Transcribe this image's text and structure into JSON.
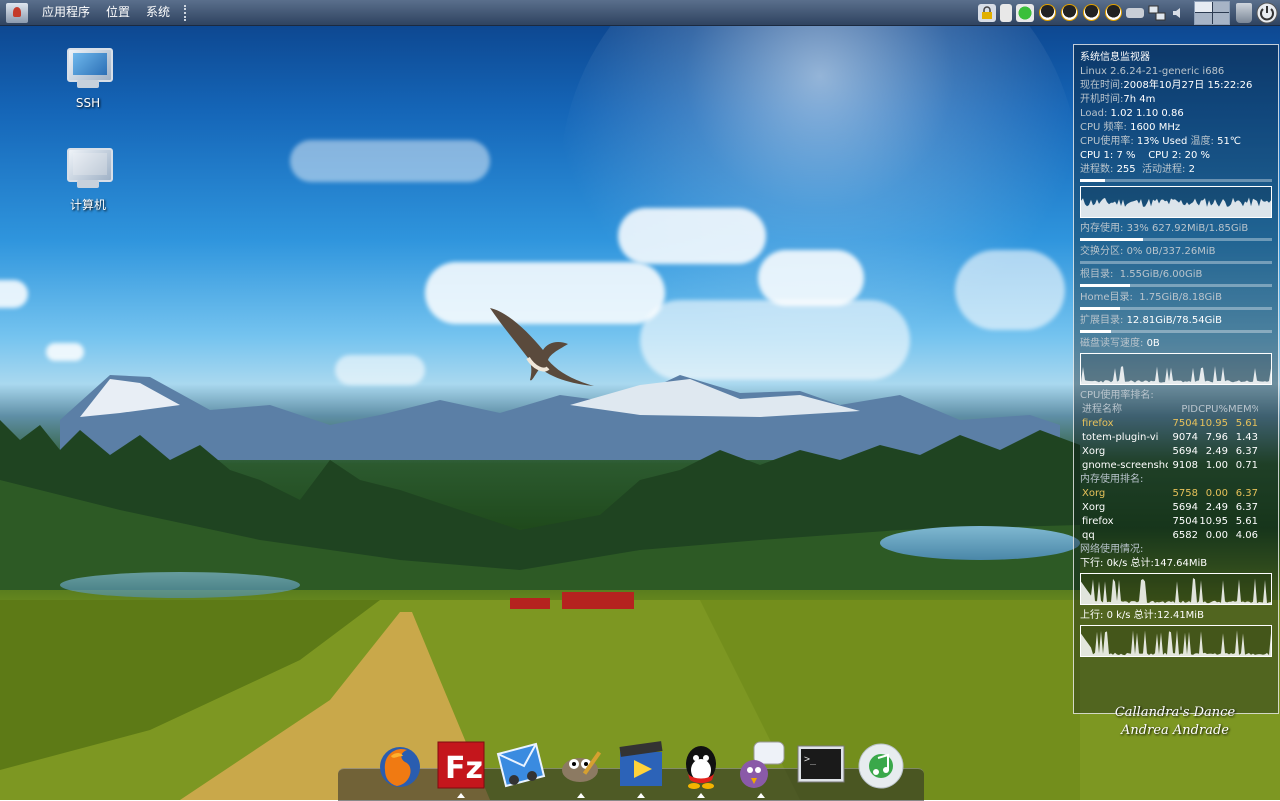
{
  "panel": {
    "menus": [
      "应用程序",
      "位置",
      "系统"
    ]
  },
  "desktop": {
    "icons": [
      {
        "label": "SSH",
        "icon": "server-icon"
      },
      {
        "label": "计算机",
        "icon": "computer-icon"
      }
    ]
  },
  "conky": {
    "title": "系统信息监视器",
    "kernel": "Linux 2.6.24-21-generic i686",
    "time_label": "现在时间:",
    "time_value": "2008年10月27日 15:22:26",
    "uptime_label": "开机时间:",
    "uptime_value": "7h 4m",
    "load_label": "Load:",
    "load_value": "1.02 1.10 0.86",
    "cpufreq_label": "CPU 频率:",
    "cpufreq_value": "1600 MHz",
    "cpuuse_label": "CPU使用率:",
    "cpuuse_value": "13% Used",
    "temp_label": "温度:",
    "temp_value": "51℃",
    "cpu1_label": "CPU 1:",
    "cpu1_value": "7 %",
    "cpu2_label": "CPU 2:",
    "cpu2_value": "20 %",
    "procs_label": "进程数:",
    "procs_value": "255",
    "active_label": "活动进程:",
    "active_value": "2",
    "mem_label": "内存使用:",
    "mem_value": "33% 627.92MiB/1.85GiB",
    "swap_label": "交换分区:",
    "swap_value": "0% 0B/337.26MiB",
    "root_label": "根目录:",
    "root_value": "1.55GiB/6.00GiB",
    "home_label": "Home目录:",
    "home_value": "1.75GiB/8.18GiB",
    "ext_label": "扩展目录:",
    "ext_value": "12.81GiB/78.54GiB",
    "diskio_label": "磁盘读写速度:",
    "diskio_value": "0B",
    "cpu_rank_title": "CPU使用率排名:",
    "proc_header": {
      "name": "进程名称",
      "pid": "PID",
      "cpu": "CPU%",
      "mem": "MEM%"
    },
    "cpu_rank": [
      {
        "name": "firefox",
        "pid": "7504",
        "cpu": "10.95",
        "mem": "5.61"
      },
      {
        "name": "totem-plugin-vi",
        "pid": "9074",
        "cpu": "7.96",
        "mem": "1.43"
      },
      {
        "name": "Xorg",
        "pid": "5694",
        "cpu": "2.49",
        "mem": "6.37"
      },
      {
        "name": "gnome-screensho",
        "pid": "9108",
        "cpu": "1.00",
        "mem": "0.71"
      }
    ],
    "mem_rank_title": "内存使用排名:",
    "mem_rank": [
      {
        "name": "Xorg",
        "pid": "5758",
        "cpu": "0.00",
        "mem": "6.37"
      },
      {
        "name": "Xorg",
        "pid": "5694",
        "cpu": "2.49",
        "mem": "6.37"
      },
      {
        "name": "firefox",
        "pid": "7504",
        "cpu": "10.95",
        "mem": "5.61"
      },
      {
        "name": "qq",
        "pid": "6582",
        "cpu": "0.00",
        "mem": "4.06"
      }
    ],
    "net_title": "网络使用情况:",
    "down_label": "下行:",
    "down_value": "0k/s",
    "down_total_label": "总计:",
    "down_total": "147.64MiB",
    "up_label": "上行:",
    "up_value": "0 k/s",
    "up_total_label": "总计:",
    "up_total": "12.41MiB",
    "levels": {
      "cpu": 0.13,
      "mem": 0.33,
      "swap": 0.0,
      "root": 0.26,
      "home": 0.21,
      "ext": 0.16
    }
  },
  "signature": {
    "line1": "Callandra's Dance",
    "line2": "Andrea Andrade"
  },
  "dock": {
    "apps": [
      "firefox-icon",
      "filezilla-icon",
      "mail-icon",
      "gimp-icon",
      "media-icon",
      "qq-icon",
      "pidgin-icon",
      "terminal-icon",
      "music-icon"
    ]
  },
  "colors": {
    "panel": "#3f5574",
    "highlight": "#e7c25a"
  }
}
